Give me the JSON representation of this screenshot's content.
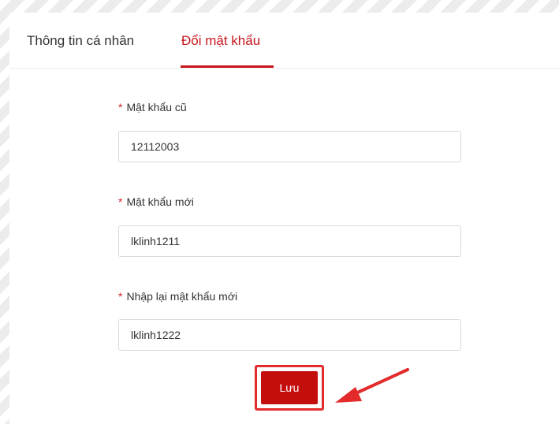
{
  "tabs": [
    {
      "label": "Thông tin cá nhân",
      "active": false
    },
    {
      "label": "Đổi mật khẩu",
      "active": true
    }
  ],
  "form": {
    "required_mark": "*",
    "old_password": {
      "label": "Mật khẩu cũ",
      "value": "12112003"
    },
    "new_password": {
      "label": "Mật khẩu mới",
      "value": "lklinh1211"
    },
    "confirm_password": {
      "label": "Nhập lại mật khẩu mới",
      "value": "lklinh1222"
    },
    "save_label": "Lưu"
  },
  "colors": {
    "accent": "#c8161d",
    "annotation": "#e32b2b"
  },
  "annotation": {
    "icon": "arrow-pointer-icon"
  }
}
